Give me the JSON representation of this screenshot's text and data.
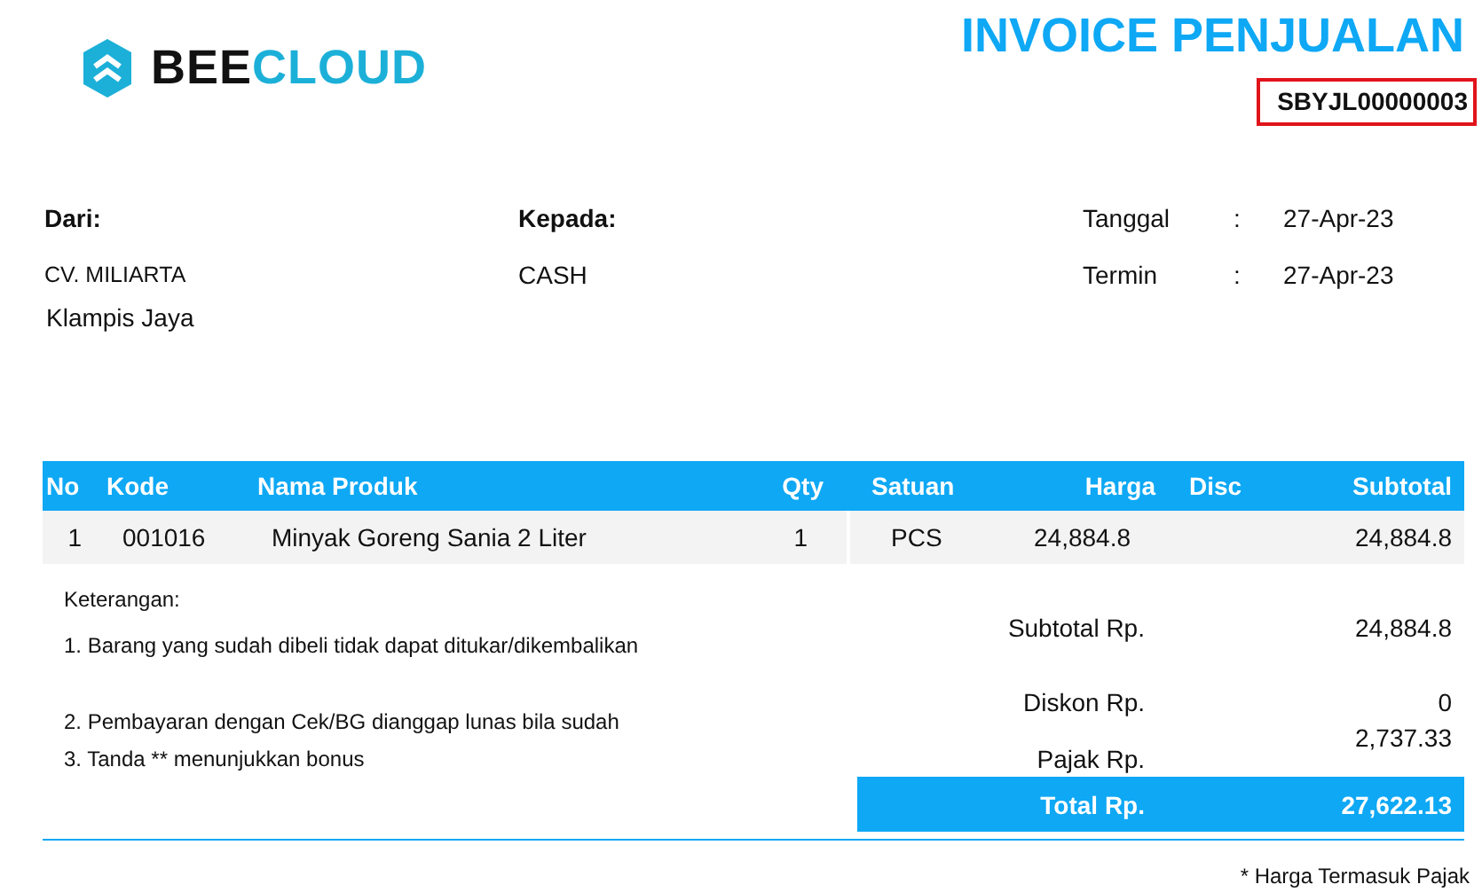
{
  "logo": {
    "text_dark": "BEE",
    "text_accent": "CLOUD"
  },
  "title": "INVOICE PENJUALAN",
  "invoice_number": "SBYJL00000003",
  "from": {
    "label": "Dari:",
    "name": "CV. MILIARTA",
    "address": "Klampis Jaya"
  },
  "to": {
    "label": "Kepada:",
    "name": "CASH"
  },
  "details": [
    {
      "label": "Tanggal",
      "separator": ":",
      "value": "27-Apr-23"
    },
    {
      "label": "Termin",
      "separator": ":",
      "value": "27-Apr-23"
    }
  ],
  "table": {
    "columns": [
      "No",
      "Kode",
      "Nama Produk",
      "Qty",
      "Satuan",
      "Harga",
      "Disc",
      "Subtotal"
    ],
    "rows": [
      [
        "1",
        "001016",
        "Minyak Goreng Sania 2 Liter",
        "1",
        "PCS",
        "24,884.8",
        "",
        "24,884.8"
      ]
    ]
  },
  "notes": {
    "heading": "Keterangan:",
    "items": [
      "1. Barang yang sudah dibeli tidak dapat ditukar/dikembalikan",
      "2. Pembayaran dengan Cek/BG dianggap lunas bila sudah",
      "3. Tanda ** menunjukkan bonus"
    ]
  },
  "summary": [
    {
      "kind": "plain",
      "label": "Subtotal Rp.",
      "value": "24,884.8"
    },
    {
      "kind": "plain",
      "label": "Diskon Rp.",
      "value": "0"
    },
    {
      "kind": "plain",
      "label": "Pajak Rp.",
      "value": "2,737.33"
    },
    {
      "kind": "total",
      "label": "Total Rp.",
      "value": "27,622.13"
    }
  ],
  "footnote": "* Harga Termasuk Pajak"
}
